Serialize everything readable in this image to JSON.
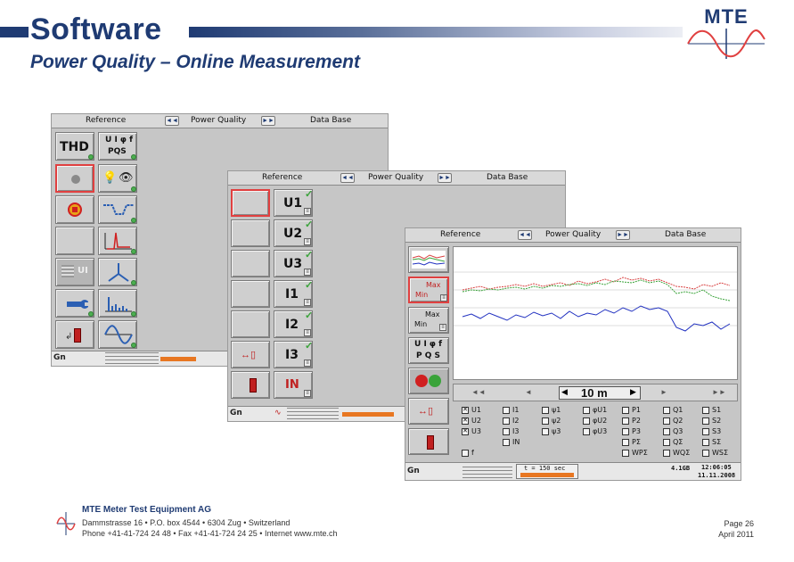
{
  "slide": {
    "title": "Software",
    "subtitle": "Power Quality – Online Measurement",
    "logo_text": "MTE"
  },
  "panel1": {
    "tabs": [
      "Reference",
      "Power Quality",
      "Data Base"
    ],
    "buttons": [
      "THD",
      "U I φ f",
      "PQS"
    ],
    "status_gn": "Gn"
  },
  "panel2": {
    "tabs": [
      "Reference",
      "Power Quality",
      "Data Base"
    ],
    "channels": [
      "U1",
      "U2",
      "U3",
      "I1",
      "I2",
      "I3"
    ],
    "status_gn": "Gn"
  },
  "panel3": {
    "tabs": [
      "Reference",
      "Power Quality",
      "Data Base"
    ],
    "max_label": "Max",
    "min_label": "Min",
    "uif_label": "U I φ f",
    "pqs_label": "P Q S",
    "time_window": "10 m",
    "checkboxes": {
      "col1": [
        "U1",
        "U2",
        "U3",
        "f"
      ],
      "col2": [
        "I1",
        "I2",
        "I3",
        "IN"
      ],
      "col3": [
        "ψ1",
        "ψ2",
        "ψ3"
      ],
      "col4": [
        "φU1",
        "φU2",
        "φU3"
      ],
      "col5": [
        "P1",
        "P2",
        "P3",
        "PΣ",
        "WPΣ"
      ],
      "col6": [
        "Q1",
        "Q2",
        "Q3",
        "QΣ",
        "WQΣ"
      ],
      "col7": [
        "S1",
        "S2",
        "S3",
        "SΣ",
        "WSΣ"
      ]
    },
    "status_time": "t = 150 sec",
    "status_mem": "4.1GB",
    "status_clock_time": "12:06:05",
    "status_clock_date": "11.11.2008",
    "status_gn": "Gn"
  },
  "footer": {
    "company": "MTE Meter Test Equipment AG",
    "address": "Dammstrasse 16 • P.O. box 4544 • 6304 Zug • Switzerland",
    "contact": "Phone +41-41-724 24 48 • Fax +41-41-724 24 25 • Internet www.mte.ch",
    "page": "Page 26",
    "date": "April 2011"
  },
  "colors": {
    "brand": "#1f3b73",
    "accent_orange": "#e87722",
    "trace_red": "#d84040",
    "trace_green": "#3aa33a",
    "trace_blue": "#2030c0"
  }
}
